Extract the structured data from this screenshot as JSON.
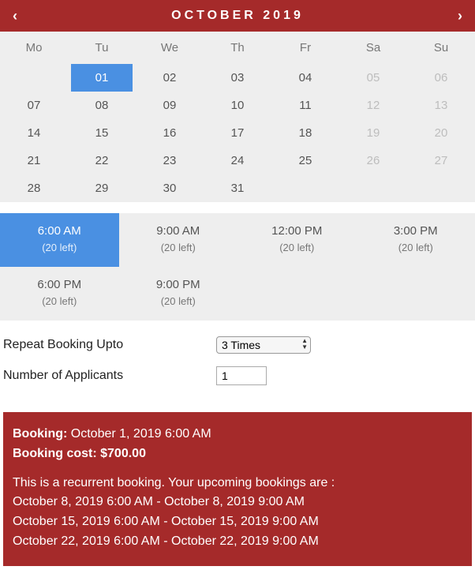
{
  "calendar": {
    "title": "OCTOBER 2019",
    "dow": [
      "Mo",
      "Tu",
      "We",
      "Th",
      "Fr",
      "Sa",
      "Su"
    ],
    "rows": [
      [
        {
          "label": "",
          "type": "empty"
        },
        {
          "label": "01",
          "type": "sel"
        },
        {
          "label": "02",
          "type": "on"
        },
        {
          "label": "03",
          "type": "on"
        },
        {
          "label": "04",
          "type": "on"
        },
        {
          "label": "05",
          "type": "dis"
        },
        {
          "label": "06",
          "type": "dis"
        }
      ],
      [
        {
          "label": "07",
          "type": "on"
        },
        {
          "label": "08",
          "type": "on"
        },
        {
          "label": "09",
          "type": "on"
        },
        {
          "label": "10",
          "type": "on"
        },
        {
          "label": "11",
          "type": "on"
        },
        {
          "label": "12",
          "type": "dis"
        },
        {
          "label": "13",
          "type": "dis"
        }
      ],
      [
        {
          "label": "14",
          "type": "on"
        },
        {
          "label": "15",
          "type": "on"
        },
        {
          "label": "16",
          "type": "on"
        },
        {
          "label": "17",
          "type": "on"
        },
        {
          "label": "18",
          "type": "on"
        },
        {
          "label": "19",
          "type": "dis"
        },
        {
          "label": "20",
          "type": "dis"
        }
      ],
      [
        {
          "label": "21",
          "type": "on"
        },
        {
          "label": "22",
          "type": "on"
        },
        {
          "label": "23",
          "type": "on"
        },
        {
          "label": "24",
          "type": "on"
        },
        {
          "label": "25",
          "type": "on"
        },
        {
          "label": "26",
          "type": "dis"
        },
        {
          "label": "27",
          "type": "dis"
        }
      ],
      [
        {
          "label": "28",
          "type": "on"
        },
        {
          "label": "29",
          "type": "on"
        },
        {
          "label": "30",
          "type": "on"
        },
        {
          "label": "31",
          "type": "on"
        },
        {
          "label": "",
          "type": "empty"
        },
        {
          "label": "",
          "type": "empty"
        },
        {
          "label": "",
          "type": "empty"
        }
      ]
    ]
  },
  "slots": [
    {
      "time": "6:00 AM",
      "avail": "(20 left)",
      "sel": true
    },
    {
      "time": "9:00 AM",
      "avail": "(20 left)",
      "sel": false
    },
    {
      "time": "12:00 PM",
      "avail": "(20 left)",
      "sel": false
    },
    {
      "time": "3:00 PM",
      "avail": "(20 left)",
      "sel": false
    },
    {
      "time": "6:00 PM",
      "avail": "(20 left)",
      "sel": false
    },
    {
      "time": "9:00 PM",
      "avail": "(20 left)",
      "sel": false
    }
  ],
  "form": {
    "repeat_label": "Repeat Booking Upto",
    "repeat_value": "3 Times",
    "applicants_label": "Number of Applicants",
    "applicants_value": "1"
  },
  "summary": {
    "booking_label": "Booking:",
    "booking_value": "October 1, 2019 6:00 AM",
    "cost_label": "Booking cost:",
    "cost_value": "$700.00",
    "recurrent_text": "This is a recurrent booking. Your upcoming bookings are :",
    "upcoming": [
      "October 8, 2019 6:00 AM - October 8, 2019 9:00 AM",
      "October 15, 2019 6:00 AM - October 15, 2019 9:00 AM",
      "October 22, 2019 6:00 AM - October 22, 2019 9:00 AM"
    ]
  }
}
